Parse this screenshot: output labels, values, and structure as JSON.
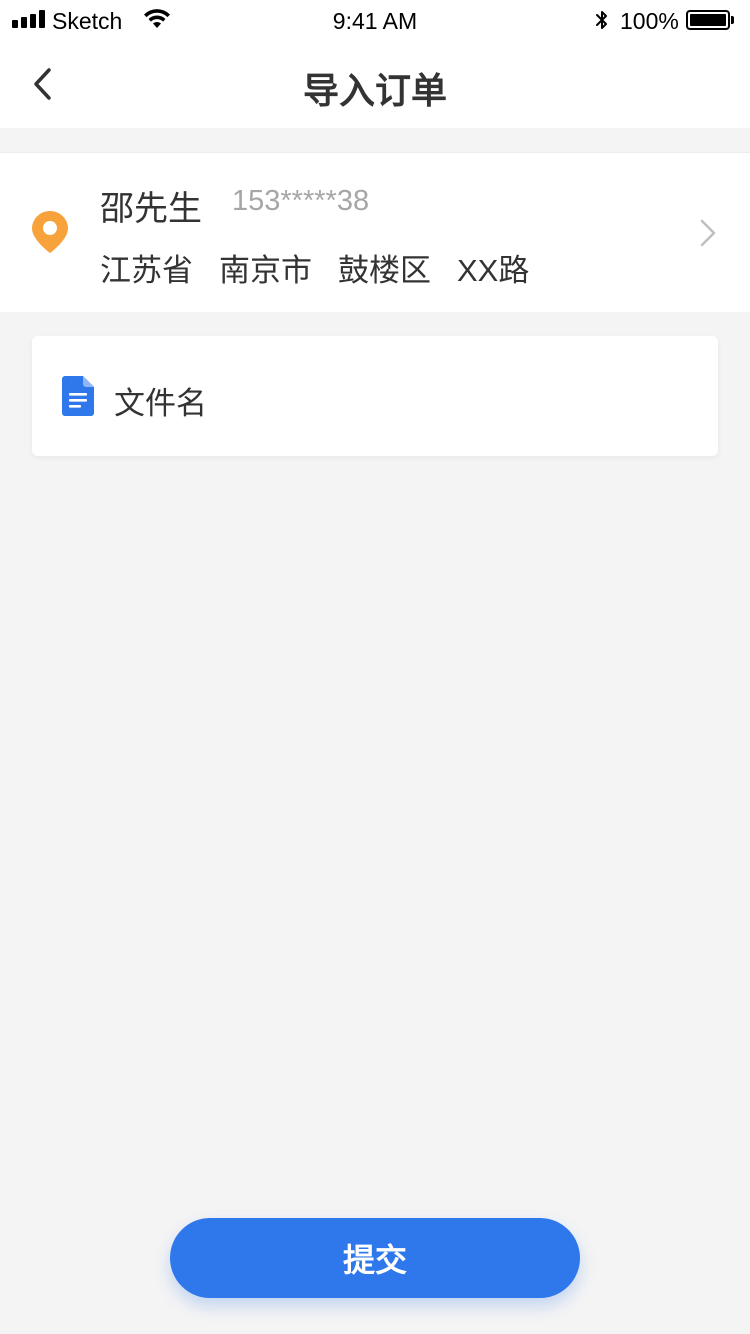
{
  "status_bar": {
    "carrier": "Sketch",
    "time": "9:41 AM",
    "battery": "100%"
  },
  "nav": {
    "title": "导入订单",
    "back_icon": "chevron-left-icon"
  },
  "address": {
    "name": "邵先生",
    "phone": "153*****38",
    "province": "江苏省",
    "city": "南京市",
    "district": "鼓楼区",
    "street": "XX路",
    "pin_color": "#f7a23b"
  },
  "file": {
    "name": "文件名",
    "icon_color": "#2e78ec"
  },
  "submit": {
    "label": "提交",
    "color": "#2e78ec"
  }
}
